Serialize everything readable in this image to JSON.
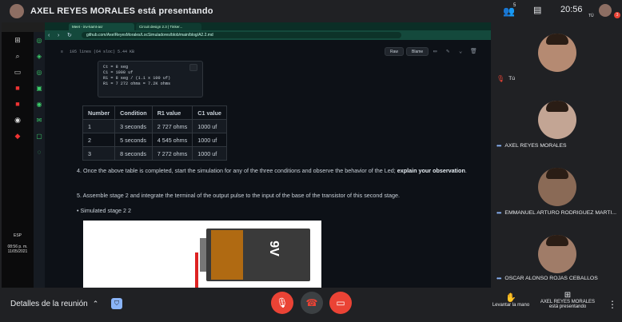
{
  "header": {
    "title": "AXEL REYES MORALES está presentando"
  },
  "top_right": {
    "people_count": "5",
    "time": "20:56",
    "self_label": "TÚ"
  },
  "browser": {
    "tabs": [
      "Meet - inv-kamt-acr",
      "Circuit design 2.3 | Tinker..."
    ],
    "url": "github.com/AxelReyesMorales/LocSimuladores/blob/main/blog/A2.2.md",
    "file_info": "105 lines (64 sloc)    5.44 KB",
    "raw_label": "Raw",
    "blame_label": "Blame"
  },
  "code_lines": [
    "Ct = 8 seg",
    "C1 = 1000 uf",
    "R1 = 8 seg / (1.1 x 100 uf)",
    "R1 = 7 272 ohms = 7.2K ohms"
  ],
  "table": {
    "headers": [
      "Number",
      "Condition",
      "R1 value",
      "C1 value"
    ],
    "rows": [
      [
        "1",
        "3 seconds",
        "2 727 ohms",
        "1000 uf"
      ],
      [
        "2",
        "5 seconds",
        "4 545 ohms",
        "1000 uf"
      ],
      [
        "3",
        "8 seconds",
        "7 272 ohms",
        "1000 uf"
      ]
    ]
  },
  "paragraphs": {
    "p4": "4. Once the above table is completed, start the simulation for any of the three conditions and observe the behavior of the Led;",
    "p4_bold": "explain your observation",
    "p4_end": ".",
    "p5": "5. Assemble stage 2 and integrate the terminal of the output pulse to the input of the base of the transistor of this second stage.",
    "bullet": "Simulated stage 2 2"
  },
  "battery_label": "9V",
  "taskbar": {
    "time": "08:56 p. m.",
    "date": "11/05/2021",
    "lang": "ESP"
  },
  "participants": [
    {
      "name": "Tú",
      "muted": true
    },
    {
      "name": "AXEL REYES MORALES"
    },
    {
      "name": "EMMANUEL ARTURO RODRIGUEZ MARTI..."
    },
    {
      "name": "OSCAR ALONSO ROJAS CEBALLOS"
    }
  ],
  "bottom": {
    "meeting_details": "Detalles de la reunión",
    "raise_hand": "Levantar la mano",
    "presenter_name": "AXEL REYES MORALES",
    "presenter_status": "está presentando"
  },
  "colors": {
    "mute_red": "#ea4335",
    "accent_blue": "#8ab4f8",
    "bg": "#202124"
  }
}
